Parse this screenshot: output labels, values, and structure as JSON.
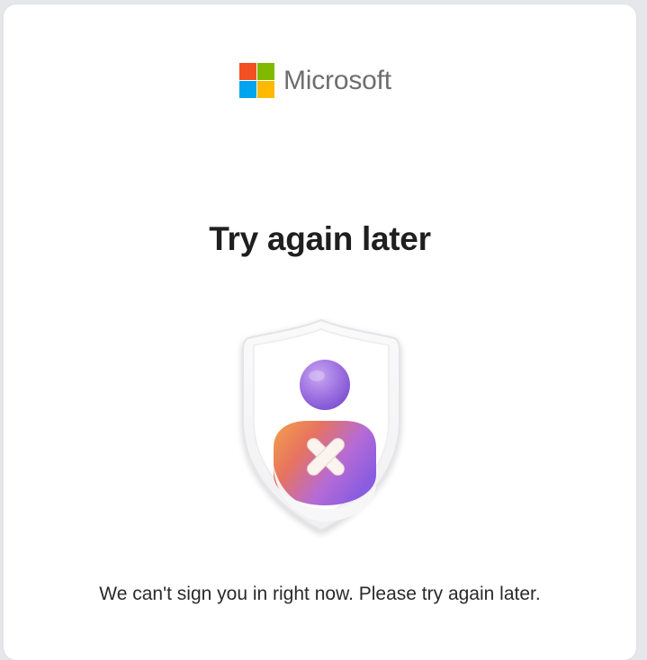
{
  "brand": {
    "name": "Microsoft",
    "logo_colors": [
      "#f25022",
      "#7fba00",
      "#00a4ef",
      "#ffb900"
    ]
  },
  "dialog": {
    "title": "Try again later",
    "message": "We can't sign you in right now. Please try again later.",
    "illustration": "shield-user-error-icon"
  },
  "colors": {
    "background": "#ffffff",
    "title_text": "#1f1f1f",
    "body_text": "#2a2a2a",
    "brand_text": "#6e6e6e"
  }
}
